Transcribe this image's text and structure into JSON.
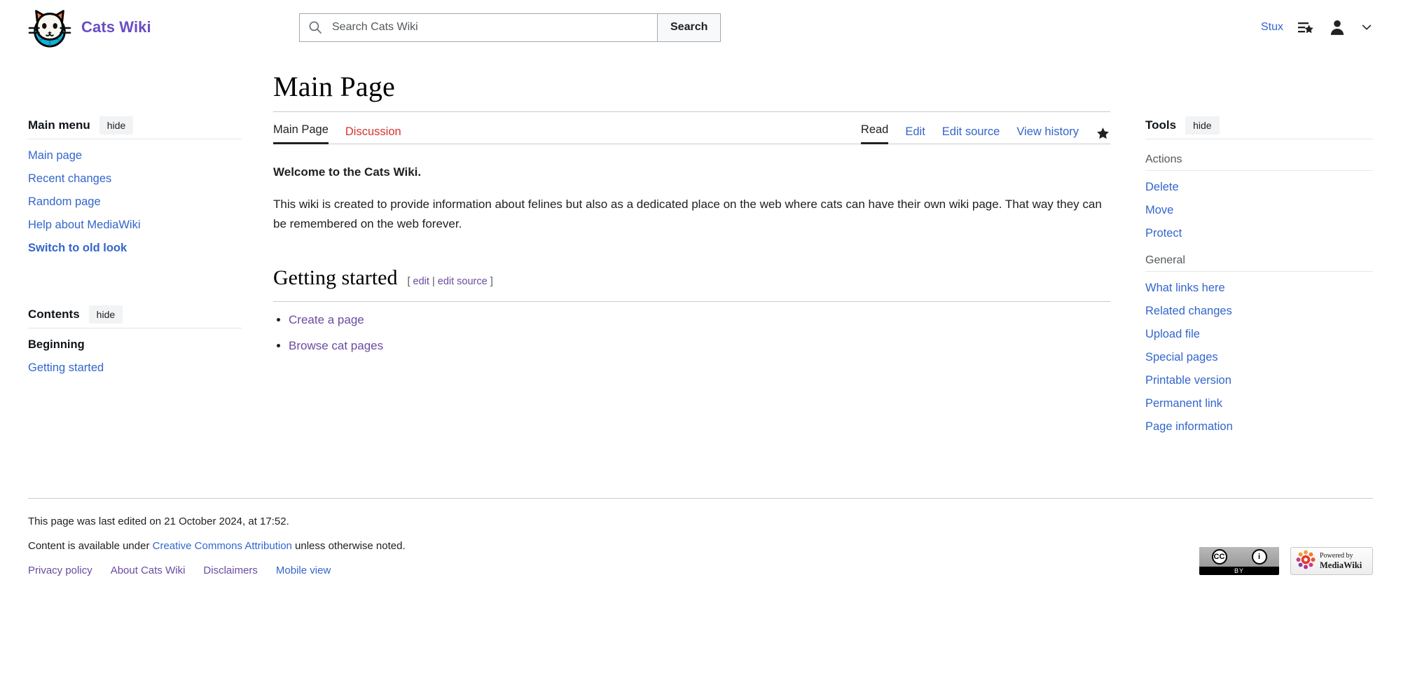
{
  "header": {
    "brand_title": "Cats Wiki",
    "logo_icon": "cat-globe-logo",
    "search": {
      "placeholder": "Search Cats Wiki",
      "value": "",
      "icon": "search-icon",
      "button_label": "Search"
    },
    "user": {
      "name": "Stux",
      "watchlist_icon": "watchlist-star-icon",
      "avatar_icon": "user-avatar-icon",
      "chevron_icon": "chevron-down-icon"
    }
  },
  "sidebar_left": {
    "main_menu": {
      "title": "Main menu",
      "hide_label": "hide",
      "items": [
        {
          "label": "Main page",
          "strong": false
        },
        {
          "label": "Recent changes",
          "strong": false
        },
        {
          "label": "Random page",
          "strong": false
        },
        {
          "label": "Help about MediaWiki",
          "strong": false
        },
        {
          "label": "Switch to old look",
          "strong": true
        }
      ]
    },
    "contents": {
      "title": "Contents",
      "hide_label": "hide",
      "items": [
        {
          "label": "Beginning",
          "current": true
        },
        {
          "label": "Getting started",
          "current": false
        }
      ]
    }
  },
  "main": {
    "page_title": "Main Page",
    "namespace_tabs": [
      {
        "label": "Main Page",
        "state": "active"
      },
      {
        "label": "Discussion",
        "state": "new"
      }
    ],
    "view_tabs": [
      {
        "label": "Read",
        "state": "active"
      },
      {
        "label": "Edit",
        "state": "link"
      },
      {
        "label": "Edit source",
        "state": "link"
      },
      {
        "label": "View history",
        "state": "link"
      }
    ],
    "watch_star_icon": "star-filled-icon",
    "lead": "Welcome to the Cats Wiki.",
    "paragraph": "This wiki is created to provide information about felines but also as a dedicated place on the web where cats can have their own wiki page. That way they can be remembered on the web forever.",
    "section": {
      "heading": "Getting started",
      "edit_open": "[",
      "edit_label": "edit",
      "edit_sep": "|",
      "edit_source_label": "edit source",
      "edit_close": "]",
      "links": [
        {
          "label": "Create a page"
        },
        {
          "label": "Browse cat pages"
        }
      ]
    }
  },
  "sidebar_right": {
    "title": "Tools",
    "hide_label": "hide",
    "groups": [
      {
        "title": "Actions",
        "items": [
          {
            "label": "Delete"
          },
          {
            "label": "Move"
          },
          {
            "label": "Protect"
          }
        ]
      },
      {
        "title": "General",
        "items": [
          {
            "label": "What links here"
          },
          {
            "label": "Related changes"
          },
          {
            "label": "Upload file"
          },
          {
            "label": "Special pages"
          },
          {
            "label": "Printable version"
          },
          {
            "label": "Permanent link"
          },
          {
            "label": "Page information"
          }
        ]
      }
    ]
  },
  "footer": {
    "last_edited": "This page was last edited on 21 October 2024, at 17:52.",
    "license_prefix": "Content is available under ",
    "license_link": "Creative Commons Attribution",
    "license_suffix": " unless otherwise noted.",
    "links": [
      {
        "label": "Privacy policy",
        "visited": true
      },
      {
        "label": "About Cats Wiki",
        "visited": true
      },
      {
        "label": "Disclaimers",
        "visited": true
      },
      {
        "label": "Mobile view",
        "visited": false
      }
    ],
    "badges": {
      "cc_letters": "CC",
      "cc_info": "i",
      "cc_by": "BY",
      "mw_line1": "Powered by",
      "mw_line2": "MediaWiki"
    }
  },
  "colors": {
    "link": "#3366cc",
    "visited": "#6b4ba1",
    "new_link": "#d73333",
    "brand": "#6a4ec4"
  }
}
